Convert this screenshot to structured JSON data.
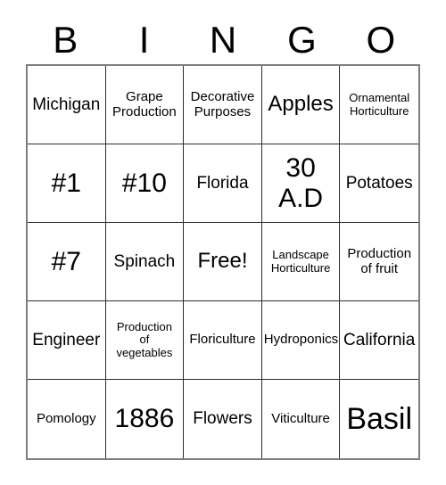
{
  "card": {
    "title": "BINGO card",
    "header_letters": [
      "B",
      "I",
      "N",
      "G",
      "O"
    ],
    "columns": 5,
    "rows": 5,
    "free_space_label": "Free!",
    "border_color": "#7d7d7d",
    "grid_line_color": "#2b2b2b",
    "background_color": "#ffffff",
    "text_color": "#000000",
    "cells": [
      [
        {
          "text": "Michigan",
          "size": "md"
        },
        {
          "text": "Grape\nProduction",
          "size": "sm"
        },
        {
          "text": "Decorative\nPurposes",
          "size": "sm"
        },
        {
          "text": "Apples",
          "size": "lg"
        },
        {
          "text": "Ornamental\nHorticulture",
          "size": "xs"
        }
      ],
      [
        {
          "text": "#1",
          "size": "xl"
        },
        {
          "text": "#10",
          "size": "xl"
        },
        {
          "text": "Florida",
          "size": "md"
        },
        {
          "text": "30\nA.D",
          "size": "xl"
        },
        {
          "text": "Potatoes",
          "size": "md"
        }
      ],
      [
        {
          "text": "#7",
          "size": "xl"
        },
        {
          "text": "Spinach",
          "size": "md"
        },
        {
          "text": "Free!",
          "size": "lg"
        },
        {
          "text": "Landscape\nHorticulture",
          "size": "xs"
        },
        {
          "text": "Production\nof fruit",
          "size": "sm"
        }
      ],
      [
        {
          "text": "Engineer",
          "size": "md"
        },
        {
          "text": "Production\nof\nvegetables",
          "size": "xs"
        },
        {
          "text": "Floriculture",
          "size": "sm"
        },
        {
          "text": "Hydroponics",
          "size": "sm"
        },
        {
          "text": "California",
          "size": "md"
        }
      ],
      [
        {
          "text": "Pomology",
          "size": "sm"
        },
        {
          "text": "1886",
          "size": "xl"
        },
        {
          "text": "Flowers",
          "size": "md"
        },
        {
          "text": "Viticulture",
          "size": "sm"
        },
        {
          "text": "Basil",
          "size": "xxl"
        }
      ]
    ]
  }
}
